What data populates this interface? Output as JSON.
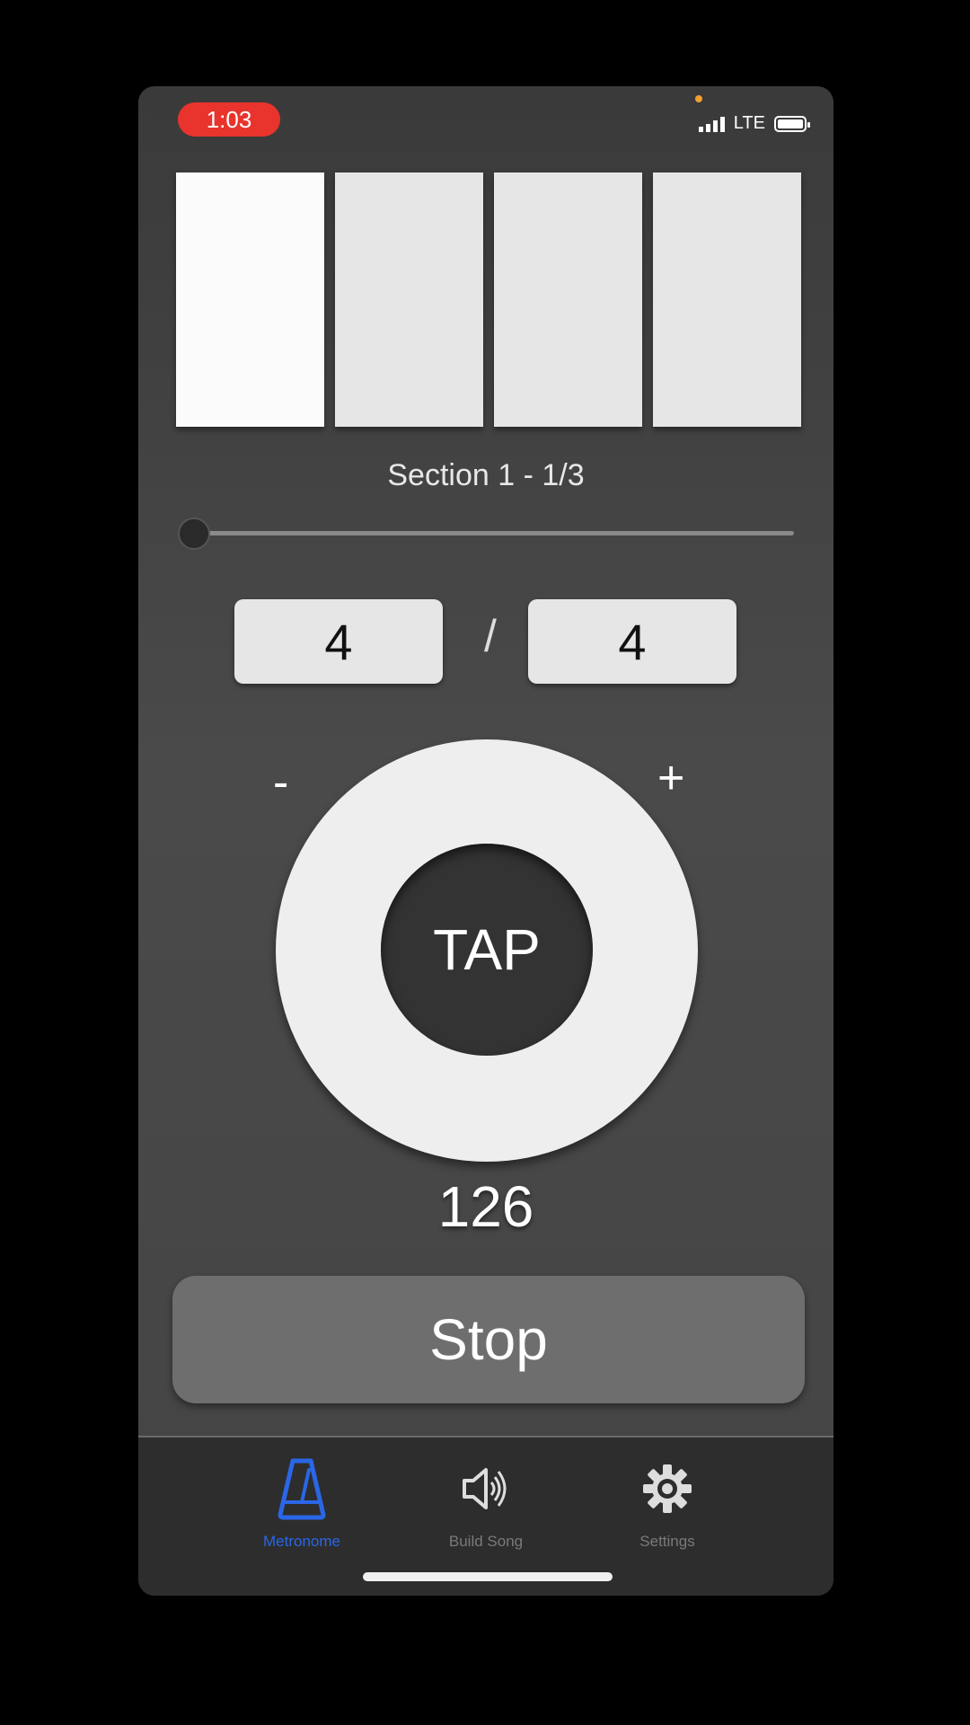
{
  "status_bar": {
    "time": "1:03",
    "network": "LTE"
  },
  "beats": {
    "count": 4,
    "active_index": 0
  },
  "section": {
    "label": "Section 1 - 1/3",
    "progress": 0.0
  },
  "time_signature": {
    "numerator": "4",
    "separator": "/",
    "denominator": "4"
  },
  "tempo": {
    "minus_label": "-",
    "plus_label": "+",
    "tap_label": "TAP",
    "bpm": "126"
  },
  "controls": {
    "stop_label": "Stop"
  },
  "tabs": [
    {
      "label": "Metronome",
      "icon": "metronome-icon",
      "active": true
    },
    {
      "label": "Build Song",
      "icon": "speaker-icon",
      "active": false
    },
    {
      "label": "Settings",
      "icon": "gear-icon",
      "active": false
    }
  ],
  "colors": {
    "accent": "#2a66e6",
    "status_pill": "#e8342c"
  }
}
